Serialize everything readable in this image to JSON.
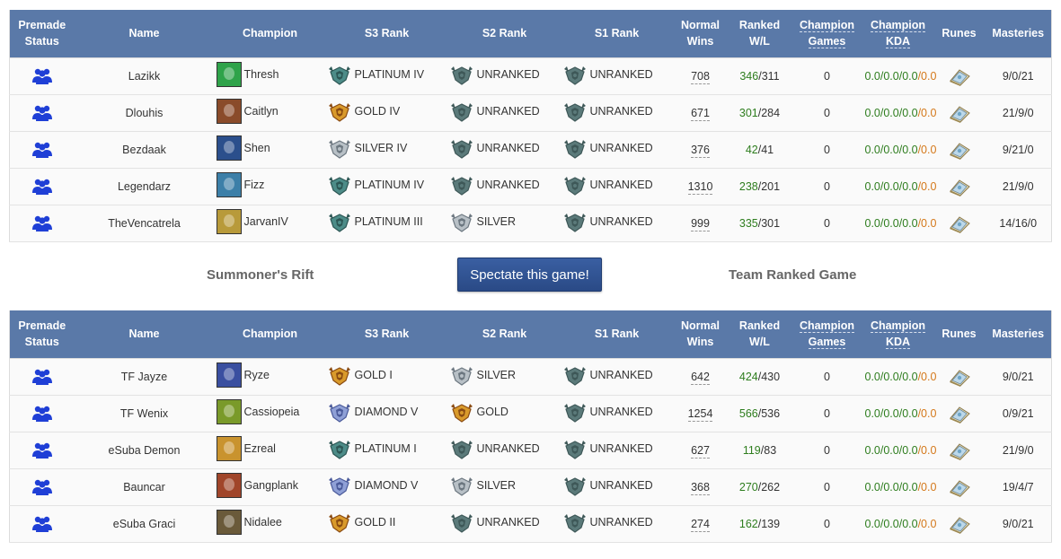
{
  "headers": {
    "premade": [
      "Premade",
      "Status"
    ],
    "name": "Name",
    "champion": "Champion",
    "s3": "S3 Rank",
    "s2": "S2 Rank",
    "s1": "S1 Rank",
    "normal": [
      "Normal",
      "Wins"
    ],
    "ranked": [
      "Ranked",
      "W/L"
    ],
    "champ_games": [
      "Champion",
      "Games"
    ],
    "champ_kda": [
      "Champion",
      "KDA"
    ],
    "runes": "Runes",
    "masteries": "Masteries"
  },
  "middle": {
    "map": "Summoner's Rift",
    "spectate_label": "Spectate this game!",
    "queue": "Team Ranked Game"
  },
  "colors": {
    "header_bg": "#5a79a8",
    "ranked_win": "#2e7d1e",
    "kda_orange": "#d4781a",
    "premade_icon": "#1f3fd6"
  },
  "teams": [
    {
      "players": [
        {
          "name": "Lazikk",
          "champion": "Thresh",
          "champ_color": "#2fa34a",
          "s3": "PLATINUM IV",
          "s3_tier": "platinum",
          "s2": "UNRANKED",
          "s2_tier": "unranked",
          "s1": "UNRANKED",
          "s1_tier": "unranked",
          "normal_wins": "708",
          "ranked_w": "346",
          "ranked_l": "/311",
          "champ_games": "0",
          "kda_a": "0.0/0.0/0.0",
          "kda_b": "/0.0",
          "masteries": "9/0/21"
        },
        {
          "name": "Dlouhis",
          "champion": "Caitlyn",
          "champ_color": "#8a4b2a",
          "s3": "GOLD IV",
          "s3_tier": "gold",
          "s2": "UNRANKED",
          "s2_tier": "unranked",
          "s1": "UNRANKED",
          "s1_tier": "unranked",
          "normal_wins": "671",
          "ranked_w": "301",
          "ranked_l": "/284",
          "champ_games": "0",
          "kda_a": "0.0/0.0/0.0",
          "kda_b": "/0.0",
          "masteries": "21/9/0"
        },
        {
          "name": "Bezdaak",
          "champion": "Shen",
          "champ_color": "#2b4f8c",
          "s3": "SILVER IV",
          "s3_tier": "silver",
          "s2": "UNRANKED",
          "s2_tier": "unranked",
          "s1": "UNRANKED",
          "s1_tier": "unranked",
          "normal_wins": "376",
          "ranked_w": "42",
          "ranked_l": "/41",
          "champ_games": "0",
          "kda_a": "0.0/0.0/0.0",
          "kda_b": "/0.0",
          "masteries": "9/21/0"
        },
        {
          "name": "Legendarz",
          "champion": "Fizz",
          "champ_color": "#3c7fa8",
          "s3": "PLATINUM IV",
          "s3_tier": "platinum",
          "s2": "UNRANKED",
          "s2_tier": "unranked",
          "s1": "UNRANKED",
          "s1_tier": "unranked",
          "normal_wins": "1310",
          "ranked_w": "238",
          "ranked_l": "/201",
          "champ_games": "0",
          "kda_a": "0.0/0.0/0.0",
          "kda_b": "/0.0",
          "masteries": "21/9/0"
        },
        {
          "name": "TheVencatrela",
          "champion": "JarvanIV",
          "champ_color": "#b89a3a",
          "s3": "PLATINUM III",
          "s3_tier": "platinum",
          "s2": "SILVER",
          "s2_tier": "silver",
          "s1": "UNRANKED",
          "s1_tier": "unranked",
          "normal_wins": "999",
          "ranked_w": "335",
          "ranked_l": "/301",
          "champ_games": "0",
          "kda_a": "0.0/0.0/0.0",
          "kda_b": "/0.0",
          "masteries": "14/16/0"
        }
      ]
    },
    {
      "players": [
        {
          "name": "TF Jayze",
          "champion": "Ryze",
          "champ_color": "#3a4fa0",
          "s3": "GOLD I",
          "s3_tier": "gold",
          "s2": "SILVER",
          "s2_tier": "silver",
          "s1": "UNRANKED",
          "s1_tier": "unranked",
          "normal_wins": "642",
          "ranked_w": "424",
          "ranked_l": "/430",
          "champ_games": "0",
          "kda_a": "0.0/0.0/0.0",
          "kda_b": "/0.0",
          "masteries": "9/0/21"
        },
        {
          "name": "TF Wenix",
          "champion": "Cassiopeia",
          "champ_color": "#7a9a2a",
          "s3": "DIAMOND V",
          "s3_tier": "diamond",
          "s2": "GOLD",
          "s2_tier": "gold",
          "s1": "UNRANKED",
          "s1_tier": "unranked",
          "normal_wins": "1254",
          "ranked_w": "566",
          "ranked_l": "/536",
          "champ_games": "0",
          "kda_a": "0.0/0.0/0.0",
          "kda_b": "/0.0",
          "masteries": "0/9/21"
        },
        {
          "name": "eSuba Demon",
          "champion": "Ezreal",
          "champ_color": "#c9932e",
          "s3": "PLATINUM I",
          "s3_tier": "platinum",
          "s2": "UNRANKED",
          "s2_tier": "unranked",
          "s1": "UNRANKED",
          "s1_tier": "unranked",
          "normal_wins": "627",
          "ranked_w": "119",
          "ranked_l": "/83",
          "champ_games": "0",
          "kda_a": "0.0/0.0/0.0",
          "kda_b": "/0.0",
          "masteries": "21/9/0"
        },
        {
          "name": "Bauncar",
          "champion": "Gangplank",
          "champ_color": "#a0452a",
          "s3": "DIAMOND V",
          "s3_tier": "diamond",
          "s2": "SILVER",
          "s2_tier": "silver",
          "s1": "UNRANKED",
          "s1_tier": "unranked",
          "normal_wins": "368",
          "ranked_w": "270",
          "ranked_l": "/262",
          "champ_games": "0",
          "kda_a": "0.0/0.0/0.0",
          "kda_b": "/0.0",
          "masteries": "19/4/7"
        },
        {
          "name": "eSuba Graci",
          "champion": "Nidalee",
          "champ_color": "#6a5a3a",
          "s3": "GOLD II",
          "s3_tier": "gold",
          "s2": "UNRANKED",
          "s2_tier": "unranked",
          "s1": "UNRANKED",
          "s1_tier": "unranked",
          "normal_wins": "274",
          "ranked_w": "162",
          "ranked_l": "/139",
          "champ_games": "0",
          "kda_a": "0.0/0.0/0.0",
          "kda_b": "/0.0",
          "masteries": "9/0/21"
        }
      ]
    }
  ]
}
